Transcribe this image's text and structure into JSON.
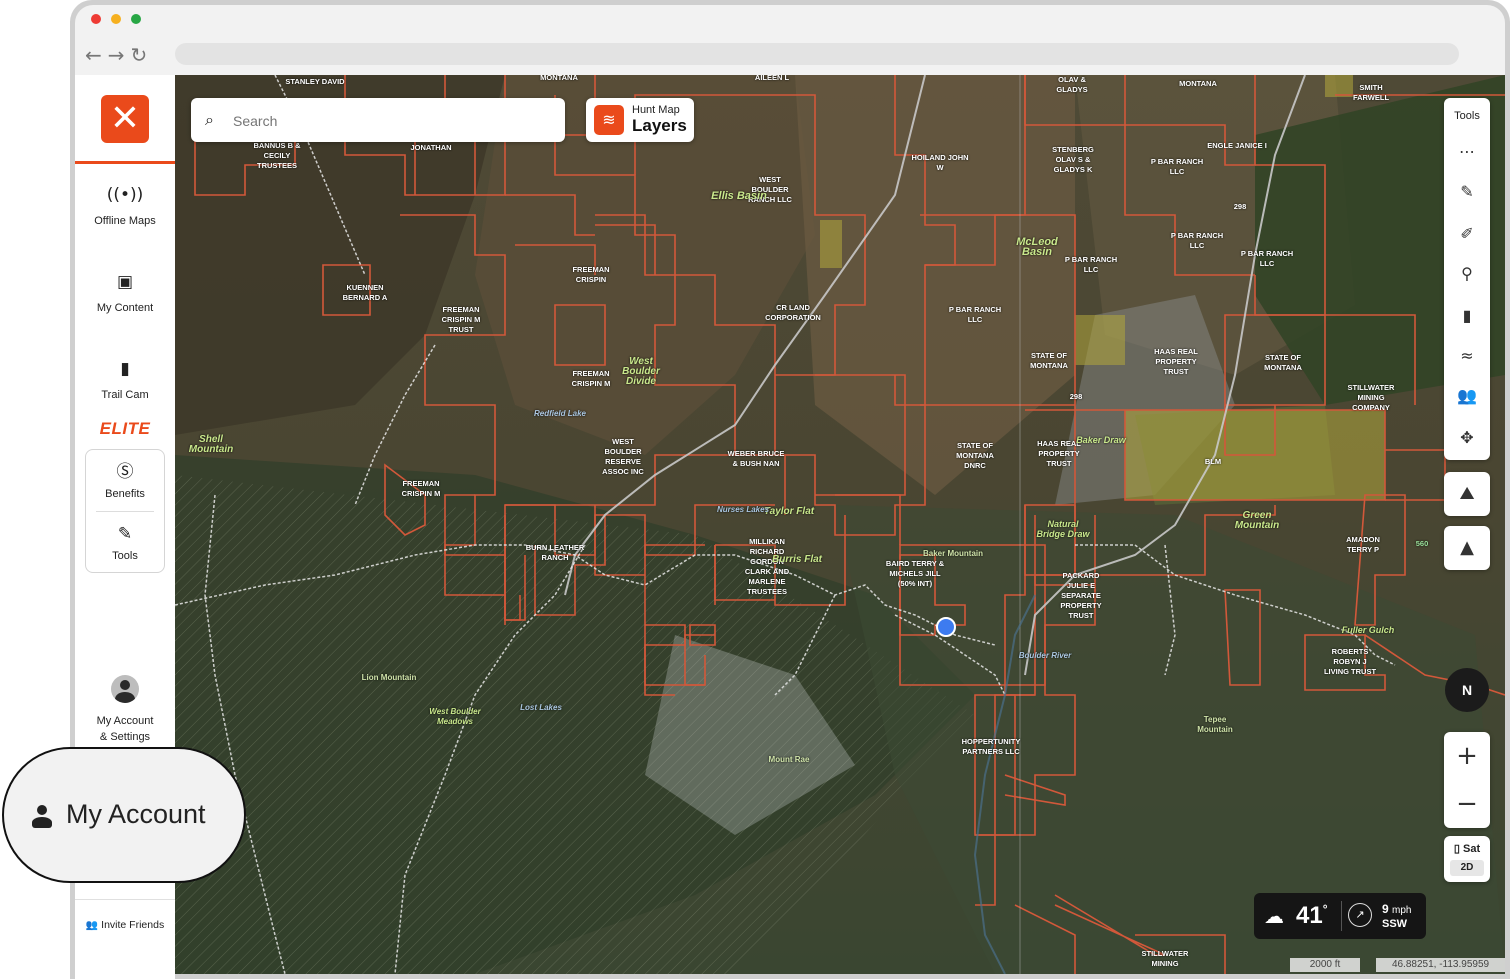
{
  "sidebar": {
    "items": [
      {
        "label": "Offline Maps",
        "icon": "offline-maps-icon"
      },
      {
        "label": "My Content",
        "icon": "folder-icon"
      },
      {
        "label": "Trail Cam",
        "icon": "trail-cam-icon"
      }
    ],
    "elite_label": "ELITE",
    "benefits_label": "Benefits",
    "tools_label": "Tools",
    "account_label_1": "My Account",
    "account_label_2": "& Settings",
    "invite_label": "Invite Friends"
  },
  "search": {
    "placeholder": "Search"
  },
  "layers": {
    "line1": "Hunt Map",
    "line2": "Layers"
  },
  "tools_panel": {
    "title": "Tools"
  },
  "compass": {
    "label": "N"
  },
  "zoom": {
    "in": "+",
    "out": "−"
  },
  "map_style": {
    "label": "Sat",
    "mode": "2D"
  },
  "weather": {
    "temp": "41",
    "unit": "°",
    "wind_speed": "9",
    "wind_unit": "mph",
    "wind_dir": "SSW"
  },
  "scale": "2000 ft",
  "coords": "46.88251, -113.95959",
  "callout": {
    "label": "My Account"
  },
  "colors": {
    "brand": "#ea4a1b",
    "parcel": "#d2583a"
  },
  "map_labels": [
    "STANLEY DAVID",
    "MONTANA",
    "AILEEN L",
    "OLAV & GLADYS",
    "MONTANA",
    "SMITH FARWELL",
    "BANNUS B & CECILY TRUSTEES",
    "JONATHAN",
    "WEST BOULDER RANCH LLC",
    "Ellis Basin",
    "HOILAND JOHN W",
    "STENBERG OLAV S & GLADYS K",
    "P BAR RANCH LLC",
    "ENGLE JANICE I",
    "McLeod Basin",
    "P BAR RANCH LLC",
    "P BAR RANCH LLC",
    "P BAR RANCH LLC",
    "KUENNEN BERNARD A",
    "FREEMAN CRISPIN",
    "FREEMAN CRISPIN M TRUST",
    "CR LAND CORPORATION",
    "P BAR RANCH LLC",
    "West Boulder Divide",
    "FREEMAN CRISPIN M",
    "Redfield Lake",
    "STATE OF MONTANA",
    "HAAS REAL PROPERTY TRUST",
    "STATE OF MONTANA",
    "STILLWATER MINING COMPANY",
    "Shell Mountain",
    "WEST BOULDER RESERVE ASSOC INC",
    "WEBER BRUCE & BUSH NAN",
    "STATE OF MONTANA DNRC",
    "HAAS REAL PROPERTY TRUST",
    "Baker Draw",
    "BLM",
    "FREEMAN CRISPIN M",
    "Taylor Flat",
    "Nurses Lakes",
    "Natural Bridge Draw",
    "Green Mountain",
    "AMADON TERRY P",
    "BURN LEATHER RANCH",
    "MILLIKAN RICHARD GORDON CLARK AND MARLENE TRUSTEES",
    "Burris Flat",
    "BAIRD TERRY & MICHELS JILL (50% INT)",
    "Baker Mountain",
    "PACKARD JULIE E SEPARATE PROPERTY TRUST",
    "Lion Mountain",
    "West Boulder Meadows",
    "Lost Lakes",
    "Fuller Gulch",
    "ROBERTS ROBYN J LIVING TRUST",
    "Tepee Mountain",
    "Mount Rae",
    "HOPPERTUNITY PARTNERS LLC",
    "STILLWATER MINING",
    "Boulder River",
    "298",
    "298",
    "560"
  ]
}
